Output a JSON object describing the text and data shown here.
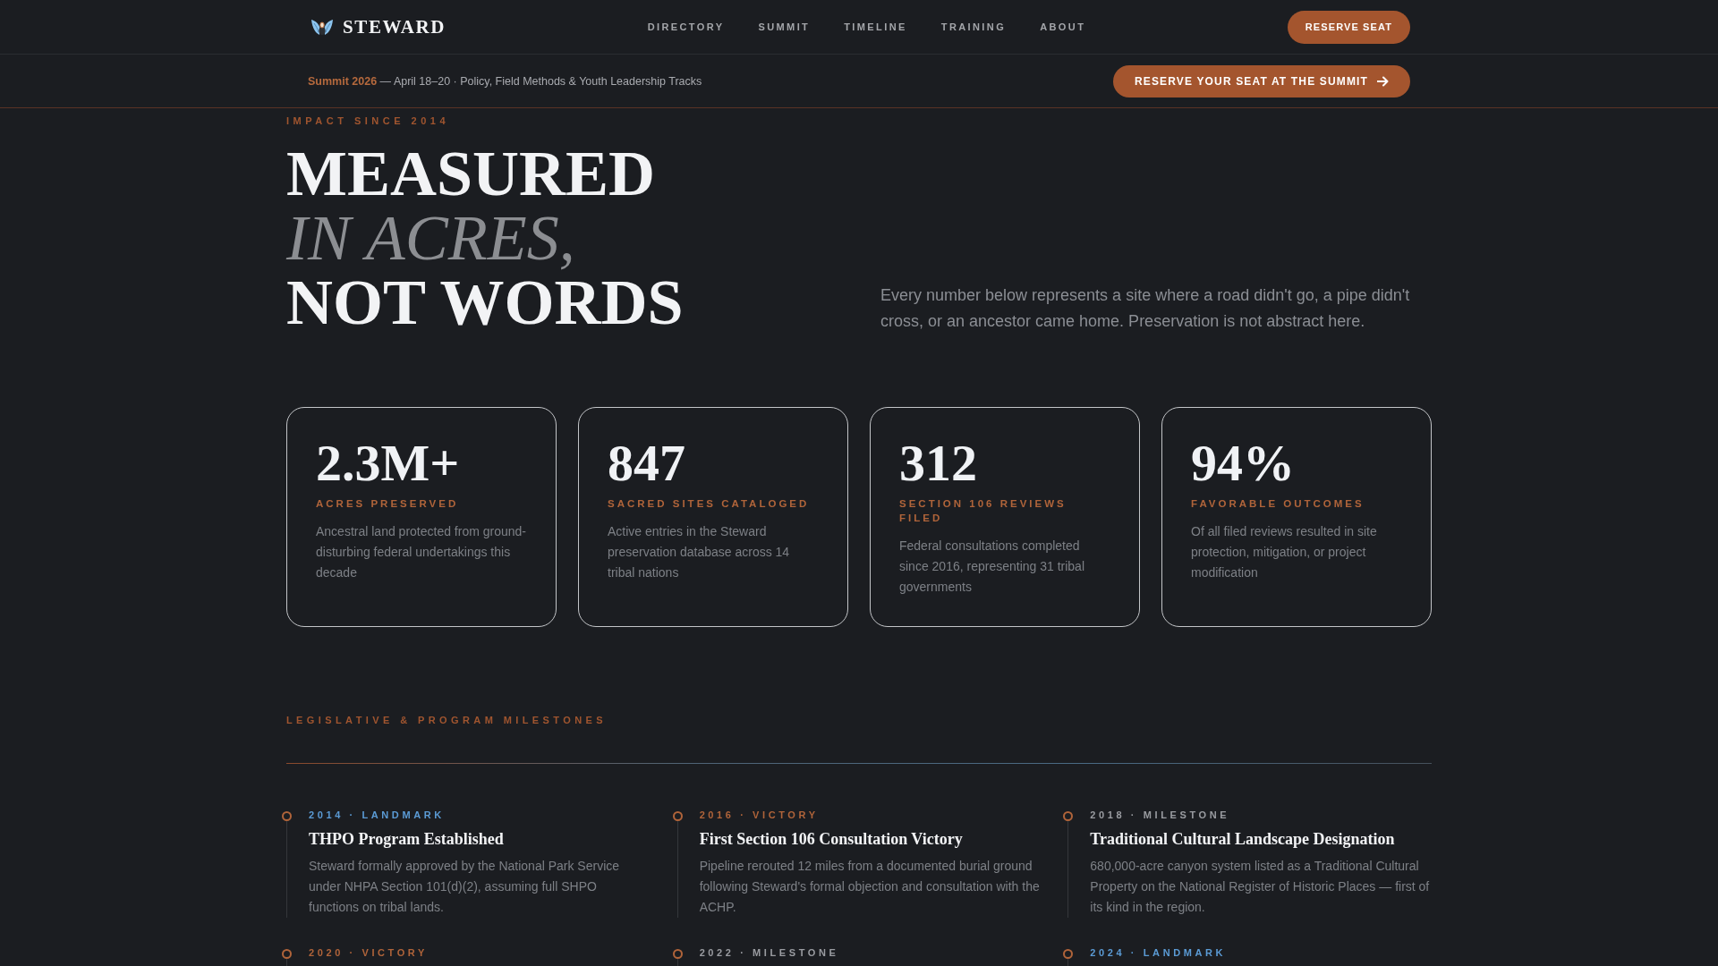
{
  "nav": {
    "brand": "STEWARD",
    "links": [
      "DIRECTORY",
      "SUMMIT",
      "TIMELINE",
      "TRAINING",
      "ABOUT"
    ],
    "button": "RESERVE SEAT"
  },
  "banner": {
    "text": "**Summit 2026** — April 18–20 · Policy, Field Methods & Youth Leadership Tracks",
    "button": "RESERVE YOUR SEAT AT THE SUMMIT"
  },
  "hero": {
    "eyebrow": "IMPACT SINCE 2014",
    "headline": [
      {
        "text": "MEASURED",
        "italic": false
      },
      {
        "text": "IN ACRES,",
        "italic": true
      },
      {
        "text": "NOT WORDS",
        "italic": false
      }
    ],
    "intro": "Every number below represents a site where a road didn't go, a pipe didn't cross, or an ancestor came home. Preservation is not abstract here."
  },
  "stats": [
    {
      "value": "2.3M+",
      "label": "ACRES PRESERVED",
      "description": "Ancestral land protected from ground-disturbing federal undertakings this decade"
    },
    {
      "value": "847",
      "label": "SACRED SITES CATALOGED",
      "description": "Active entries in the Steward preservation database across 14 tribal nations"
    },
    {
      "value": "312",
      "label": "SECTION 106 REVIEWS FILED",
      "description": "Federal consultations completed since 2016, representing 31 tribal governments"
    },
    {
      "value": "94%",
      "label": "FAVORABLE OUTCOMES",
      "description": "Of all filed reviews resulted in site protection, mitigation, or project modification"
    }
  ],
  "milestones": {
    "heading": "LEGISLATIVE & PROGRAM MILESTONES",
    "items": [
      {
        "tag": "2014 · LANDMARK",
        "color": "#5b9bd5",
        "title": "THPO Program Established",
        "description": "Steward formally approved by the National Park Service under NHPA Section 101(d)(2), assuming full SHPO functions on tribal lands."
      },
      {
        "tag": "2016 · VICTORY",
        "color": "#b0643a",
        "title": "First Section 106 Consultation Victory",
        "description": "Pipeline rerouted 12 miles from a documented burial ground following Steward's formal objection and consultation with the ACHP."
      },
      {
        "tag": "2018 · MILESTONE",
        "color": "#9a9ca1",
        "title": "Traditional Cultural Landscape Designation",
        "description": "680,000-acre canyon system listed as a Traditional Cultural Property on the National Register of Historic Places — first of its kind in the region."
      },
      {
        "tag": "2020 · VICTORY",
        "color": "#b0643a"
      },
      {
        "tag": "2022 · MILESTONE",
        "color": "#9a9ca1"
      },
      {
        "tag": "2024 · LANDMARK",
        "color": "#5b9bd5"
      }
    ]
  }
}
